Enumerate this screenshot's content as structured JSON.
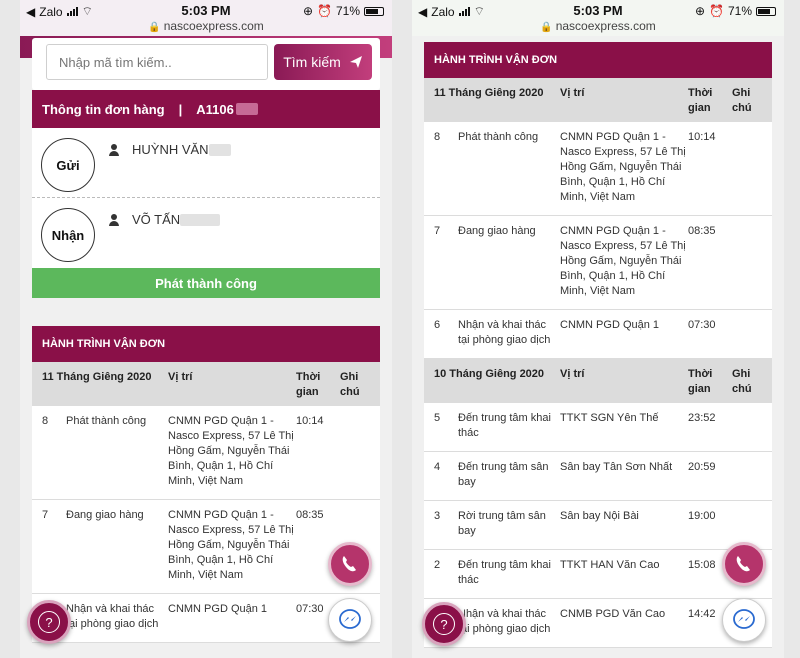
{
  "status_bar": {
    "app": "Zalo",
    "time": "5:03 PM",
    "url": "nascoexpress.com",
    "battery": "71%"
  },
  "search": {
    "placeholder": "Nhập mã tìm kiếm..",
    "button_label": "Tìm kiếm"
  },
  "order": {
    "header_label": "Thông tin đơn hàng",
    "separator": "|",
    "code": "A1106",
    "sender_label": "Gửi",
    "sender_name": "HUỲNH VĂN",
    "receiver_label": "Nhận",
    "receiver_name": "VÕ TẤN",
    "status": "Phát thành công"
  },
  "journey": {
    "title": "HÀNH TRÌNH VẬN ĐƠN",
    "col_location": "Vị trí",
    "col_time": "Thời gian",
    "col_note": "Ghi chú",
    "days": [
      {
        "date": "11 Tháng Giêng 2020",
        "rows": [
          {
            "step": "8",
            "event": "Phát thành công",
            "location": "CNMN PGD Quận 1 - Nasco Express, 57 Lê Thị Hồng Gấm, Nguyễn Thái Bình, Quận 1, Hồ Chí Minh, Việt Nam",
            "time": "10:14"
          },
          {
            "step": "7",
            "event": "Đang giao hàng",
            "location": "CNMN PGD Quận 1 - Nasco Express, 57 Lê Thị Hồng Gấm, Nguyễn Thái Bình, Quận 1, Hồ Chí Minh, Việt Nam",
            "time": "08:35"
          },
          {
            "step": "6",
            "event": "Nhận và khai thác tại phòng giao dịch",
            "location": "CNMN PGD Quận 1",
            "time": "07:30"
          }
        ]
      },
      {
        "date": "10 Tháng Giêng 2020",
        "rows": [
          {
            "step": "5",
            "event": "Đến trung tâm khai thác",
            "location": "TTKT SGN Yên Thế",
            "time": "23:52"
          },
          {
            "step": "4",
            "event": "Đến trung tâm sân bay",
            "location": "Sân bay Tân Sơn Nhất",
            "time": "20:59"
          },
          {
            "step": "3",
            "event": "Rời trung tâm sân bay",
            "location": "Sân bay Nội Bài",
            "time": "19:00"
          },
          {
            "step": "2",
            "event": "Đến trung tâm khai thác",
            "location": "TTKT HAN Văn Cao",
            "time": "15:08"
          },
          {
            "step": "1",
            "event": "Nhận và khai thác tại phòng giao dịch",
            "location": "CNMB PGD Văn Cao",
            "time": "14:42"
          }
        ]
      }
    ]
  },
  "fabs": {
    "help_glyph": "?",
    "phone_color": "#b5346b",
    "brand_color": "#8a1048",
    "success_color": "#5cb85c"
  }
}
